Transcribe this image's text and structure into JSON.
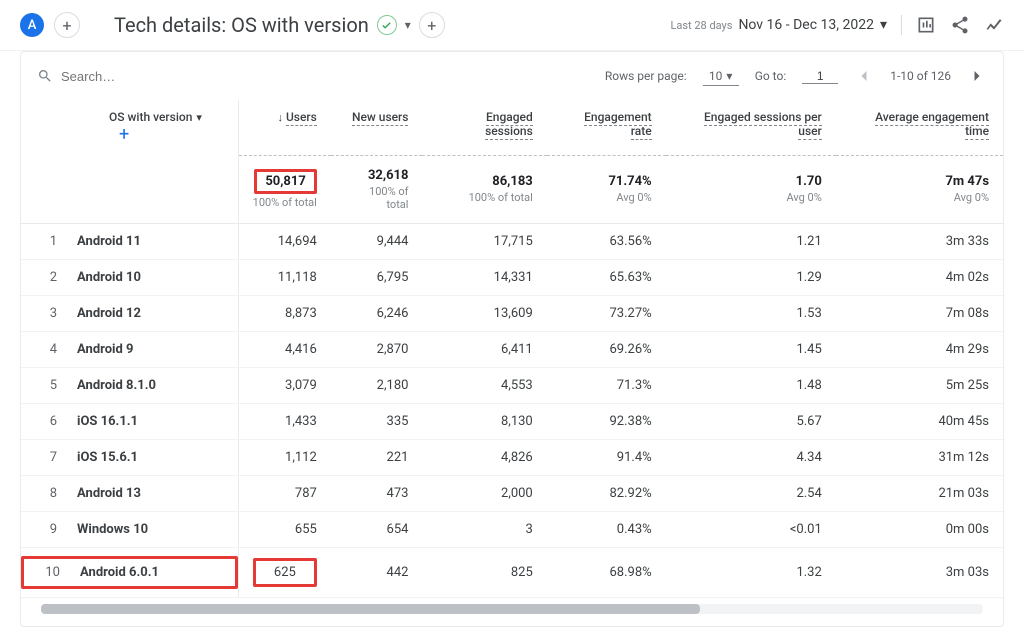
{
  "avatar_letter": "A",
  "page_title": "Tech details: OS with version",
  "date_label": "Last 28 days",
  "date_range": "Nov 16 - Dec 13, 2022",
  "search_placeholder": "Search…",
  "pagination": {
    "rows_per_page_label": "Rows per page:",
    "rows_per_page_value": "10",
    "goto_label": "Go to:",
    "goto_value": "1",
    "range_text": "1-10 of 126"
  },
  "dimension_header": "OS with version",
  "columns": [
    "Users",
    "New users",
    "Engaged sessions",
    "Engagement rate",
    "Engaged sessions per user",
    "Average engagement time"
  ],
  "totals": {
    "values": [
      "50,817",
      "32,618",
      "86,183",
      "71.74%",
      "1.70",
      "7m 47s"
    ],
    "subs": [
      "100% of total",
      "100% of total",
      "100% of total",
      "Avg 0%",
      "Avg 0%",
      "Avg 0%"
    ]
  },
  "rows": [
    {
      "idx": "1",
      "name": "Android 11",
      "v": [
        "14,694",
        "9,444",
        "17,715",
        "63.56%",
        "1.21",
        "3m 33s"
      ]
    },
    {
      "idx": "2",
      "name": "Android 10",
      "v": [
        "11,118",
        "6,795",
        "14,331",
        "65.63%",
        "1.29",
        "4m 02s"
      ]
    },
    {
      "idx": "3",
      "name": "Android 12",
      "v": [
        "8,873",
        "6,246",
        "13,609",
        "73.27%",
        "1.53",
        "7m 08s"
      ]
    },
    {
      "idx": "4",
      "name": "Android 9",
      "v": [
        "4,416",
        "2,870",
        "6,411",
        "69.26%",
        "1.45",
        "4m 29s"
      ]
    },
    {
      "idx": "5",
      "name": "Android 8.1.0",
      "v": [
        "3,079",
        "2,180",
        "4,553",
        "71.3%",
        "1.48",
        "5m 25s"
      ]
    },
    {
      "idx": "6",
      "name": "iOS 16.1.1",
      "v": [
        "1,433",
        "335",
        "8,130",
        "92.38%",
        "5.67",
        "40m 45s"
      ]
    },
    {
      "idx": "7",
      "name": "iOS 15.6.1",
      "v": [
        "1,112",
        "221",
        "4,826",
        "91.4%",
        "4.34",
        "31m 12s"
      ]
    },
    {
      "idx": "8",
      "name": "Android 13",
      "v": [
        "787",
        "473",
        "2,000",
        "82.92%",
        "2.54",
        "21m 03s"
      ]
    },
    {
      "idx": "9",
      "name": "Windows 10",
      "v": [
        "655",
        "654",
        "3",
        "0.43%",
        "<0.01",
        "0m 00s"
      ]
    },
    {
      "idx": "10",
      "name": "Android 6.0.1",
      "v": [
        "625",
        "442",
        "825",
        "68.98%",
        "1.32",
        "3m 03s"
      ]
    }
  ]
}
